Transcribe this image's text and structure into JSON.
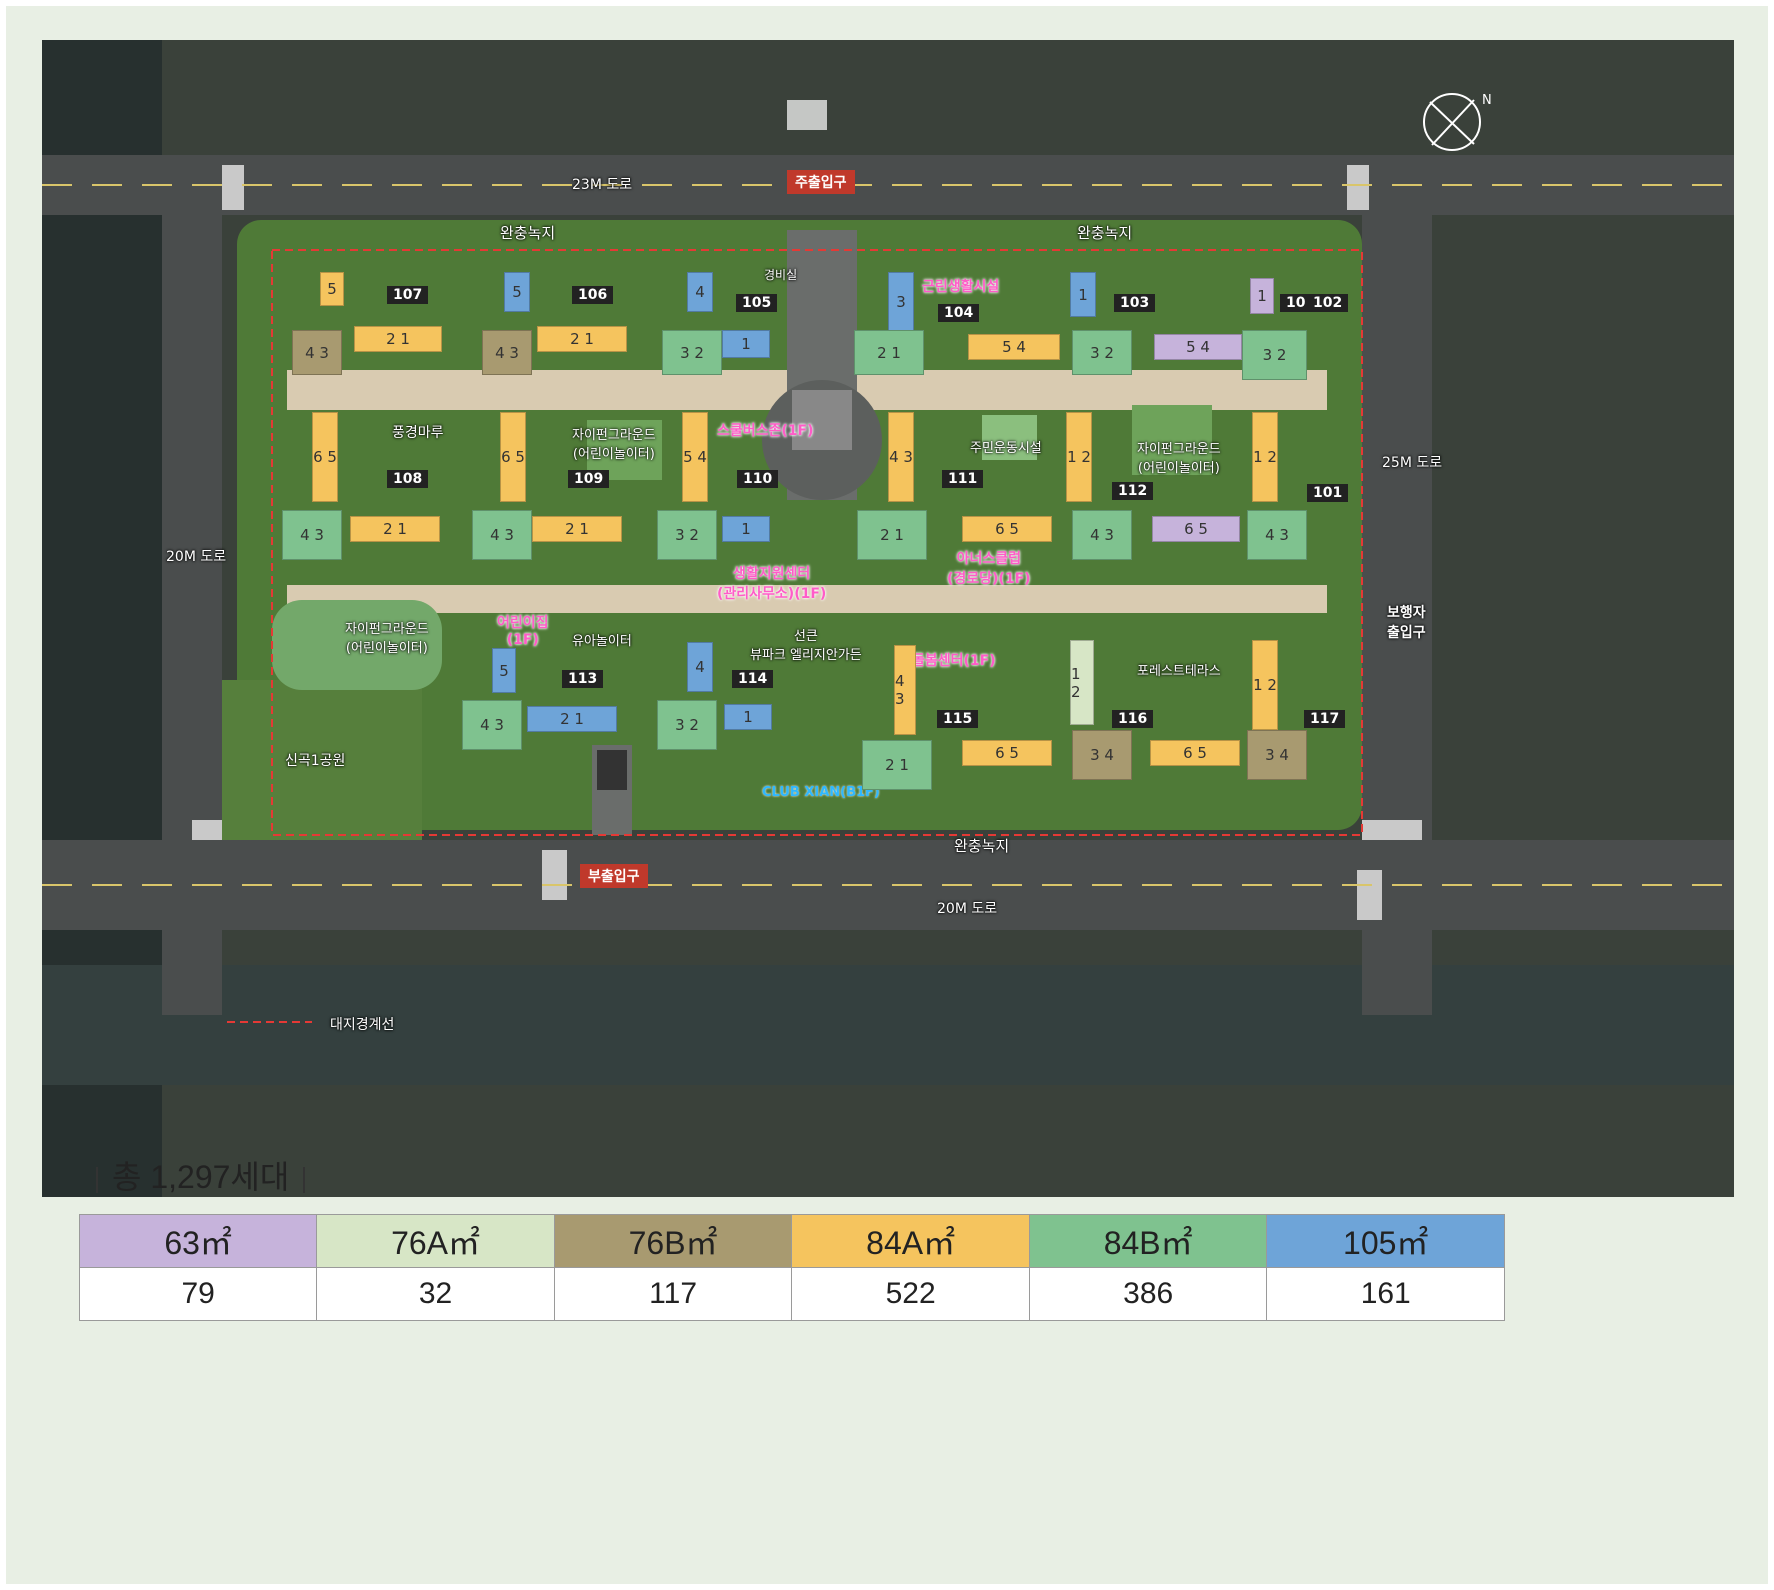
{
  "map": {
    "roads": {
      "north": "23M 도로",
      "west": "20M 도로",
      "south": "20M 도로",
      "east": "25M 도로"
    },
    "buffer_green_north_left": "완충녹지",
    "buffer_green_north_right": "완충녹지",
    "buffer_green_south": "완충녹지",
    "main_entrance": "주출입구",
    "sub_entrance": "부출입구",
    "pedestrian_entrance": "보행자\n출입구",
    "park": "신곡1공원",
    "boundary_legend": "대지경계선",
    "guard": "경비실",
    "facilities": {
      "landscape": "풍경마루",
      "playground_a": "자이펀그라운드\n(어린이놀이터)",
      "playground_b": "자이펀그라운드\n(어린이놀이터)",
      "playground_c": "자이펀그라운드\n(어린이놀이터)",
      "fitness": "주민운동시설",
      "toddler": "유아놀이터",
      "forest": "포레스트테라스",
      "garden": "선큰\n뷰파크 엘리지안가든"
    },
    "pink_facilities": {
      "retail": "근린생활시설",
      "school_bus": "스쿨버스존(1F)",
      "support": "생활지원센터\n(관리사무소)(1F)",
      "senior": "아너스클럽\n(경로당)(1F)",
      "daycare": "어린이집\n(1F)",
      "care": "돌봄센터(1F)"
    },
    "club": "CLUB XIAN(B1F)",
    "buildings": [
      "101",
      "102",
      "103",
      "104",
      "105",
      "106",
      "107",
      "108",
      "109",
      "110",
      "111",
      "112",
      "113",
      "114",
      "115",
      "116",
      "117"
    ]
  },
  "summary": {
    "total": "총 1,297세대"
  },
  "unit_types": [
    {
      "label": "63㎡",
      "count": "79",
      "color": "#c6b3db"
    },
    {
      "label": "76A㎡",
      "count": "32",
      "color": "#d7e6c6"
    },
    {
      "label": "76B㎡",
      "count": "117",
      "color": "#a89a70"
    },
    {
      "label": "84A㎡",
      "count": "522",
      "color": "#f5c45e"
    },
    {
      "label": "84B㎡",
      "count": "386",
      "color": "#7fc28f"
    },
    {
      "label": "105㎡",
      "count": "161",
      "color": "#6ea4d8"
    }
  ]
}
